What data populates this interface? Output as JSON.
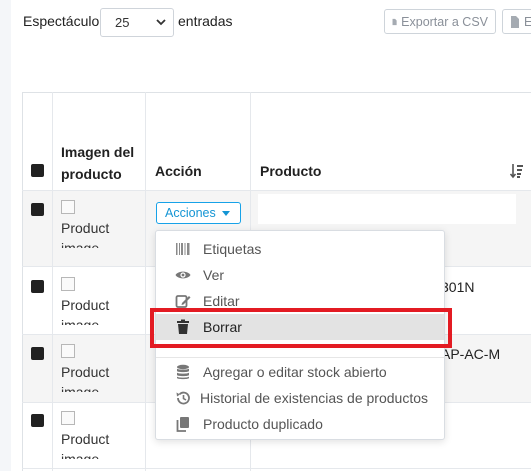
{
  "toolbar": {
    "show_label": "Espectáculo",
    "page_size_value": "25",
    "entries_label": "entradas",
    "export_csv_label": "Exportar a CSV",
    "export_excel_label": "E"
  },
  "table": {
    "headers": {
      "image": "Imagen del producto",
      "action": "Acción",
      "product": "Producto"
    },
    "rows": [
      {
        "image_alt": "Product image",
        "product": ""
      },
      {
        "image_alt": "Product image",
        "product": "301N"
      },
      {
        "image_alt": "Product image",
        "product": "AP-AC-M"
      },
      {
        "image_alt": "Product image",
        "product": ""
      }
    ],
    "actions_button_label": "Acciones"
  },
  "actions_menu": {
    "items": [
      {
        "label": "Etiquetas",
        "icon": "barcode-icon"
      },
      {
        "label": "Ver",
        "icon": "eye-icon"
      },
      {
        "label": "Editar",
        "icon": "edit-icon"
      },
      {
        "label": "Borrar",
        "icon": "trash-icon",
        "highlighted": true
      },
      {
        "label": "Agregar o editar stock abierto",
        "icon": "database-icon"
      },
      {
        "label": "Historial de existencias de productos",
        "icon": "history-icon"
      },
      {
        "label": "Producto duplicado",
        "icon": "copy-icon"
      }
    ]
  },
  "colors": {
    "accent": "#1495d4",
    "highlight_border": "#e31b23",
    "row_stripe": "#f5f5f5"
  }
}
